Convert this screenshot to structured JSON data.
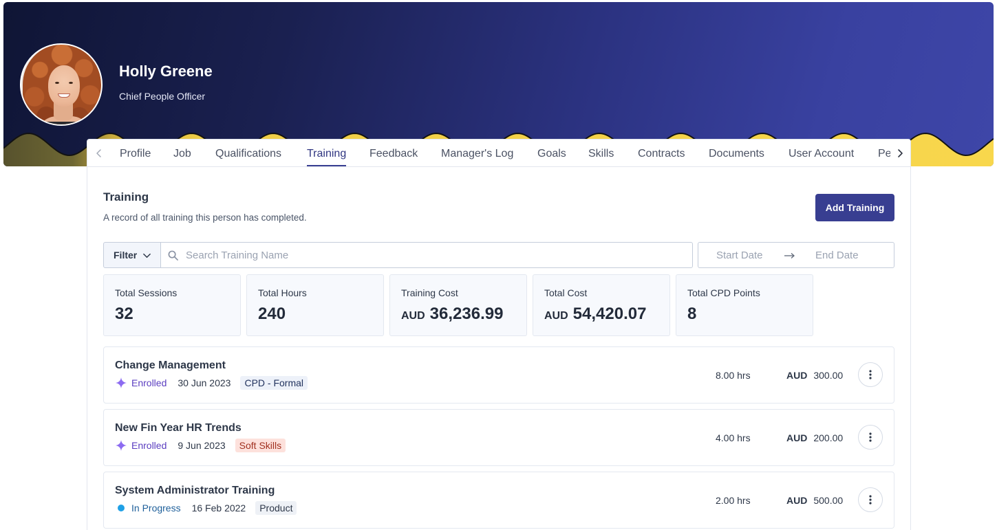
{
  "profile": {
    "name": "Holly Greene",
    "job_title": "Chief People Officer",
    "avatar_icon": "profile-photo"
  },
  "nav": {
    "prev_icon": "chevron-left-icon",
    "next_icon": "chevron-right-icon",
    "active_tab": "Training",
    "tabs": [
      {
        "label": "Profile"
      },
      {
        "label": "Job"
      },
      {
        "label": "Qualifications"
      },
      {
        "label": "Training"
      },
      {
        "label": "Feedback"
      },
      {
        "label": "Manager's Log"
      },
      {
        "label": "Goals"
      },
      {
        "label": "Skills"
      },
      {
        "label": "Contracts"
      },
      {
        "label": "Documents"
      },
      {
        "label": "User Account"
      },
      {
        "label": "Pe"
      }
    ]
  },
  "section": {
    "title": "Training",
    "subtitle": "A record of all training this person has completed.",
    "add_button": "Add Training"
  },
  "filters": {
    "filter_label": "Filter",
    "filter_icon": "chevron-down-icon",
    "search_icon": "search-icon",
    "search_placeholder": "Search Training Name",
    "start_date_placeholder": "Start Date",
    "range_icon": "arrow-right-icon",
    "end_date_placeholder": "End Date"
  },
  "stats": [
    {
      "label": "Total Sessions",
      "value": "32"
    },
    {
      "label": "Total Hours",
      "value": "240"
    },
    {
      "label": "Training Cost",
      "currency": "AUD",
      "value": "36,236.99"
    },
    {
      "label": "Total Cost",
      "currency": "AUD",
      "value": "54,420.07"
    },
    {
      "label": "Total CPD Points",
      "value": "8"
    }
  ],
  "trainings": [
    {
      "title": "Change Management",
      "status": {
        "label": "Enrolled",
        "icon": "sparkle-icon",
        "text_color": "#5a3dc0",
        "icon_color": "#8c6bf1"
      },
      "date": "30 Jun 2023",
      "tag": {
        "label": "CPD - Formal",
        "bg": "#edf1f9",
        "color": "#22335e"
      },
      "hours": "8.00 hrs",
      "currency": "AUD",
      "amount": "300.00"
    },
    {
      "title": "New Fin Year HR Trends",
      "status": {
        "label": "Enrolled",
        "icon": "sparkle-icon",
        "text_color": "#5a3dc0",
        "icon_color": "#8c6bf1"
      },
      "date": "9 Jun 2023",
      "tag": {
        "label": "Soft Skills",
        "bg": "#fde1dc",
        "color": "#a1301f"
      },
      "hours": "4.00 hrs",
      "currency": "AUD",
      "amount": "200.00"
    },
    {
      "title": "System Administrator Training",
      "status": {
        "label": "In Progress",
        "icon": "dot-icon",
        "text_color": "#1e5f9a",
        "icon_color": "#1fa0e6"
      },
      "date": "16 Feb 2022",
      "tag": {
        "label": "Product",
        "bg": "#eef1f6",
        "color": "#2d3748"
      },
      "hours": "2.00 hrs",
      "currency": "AUD",
      "amount": "500.00"
    }
  ],
  "row_action_icon": "more-vertical-icon",
  "colors": {
    "accent": "#383e91",
    "banner_dark": "#0f1535",
    "banner_light": "#3e46a8",
    "wave_yellow": "#f8d74c",
    "wave_olive": "#57522d"
  }
}
